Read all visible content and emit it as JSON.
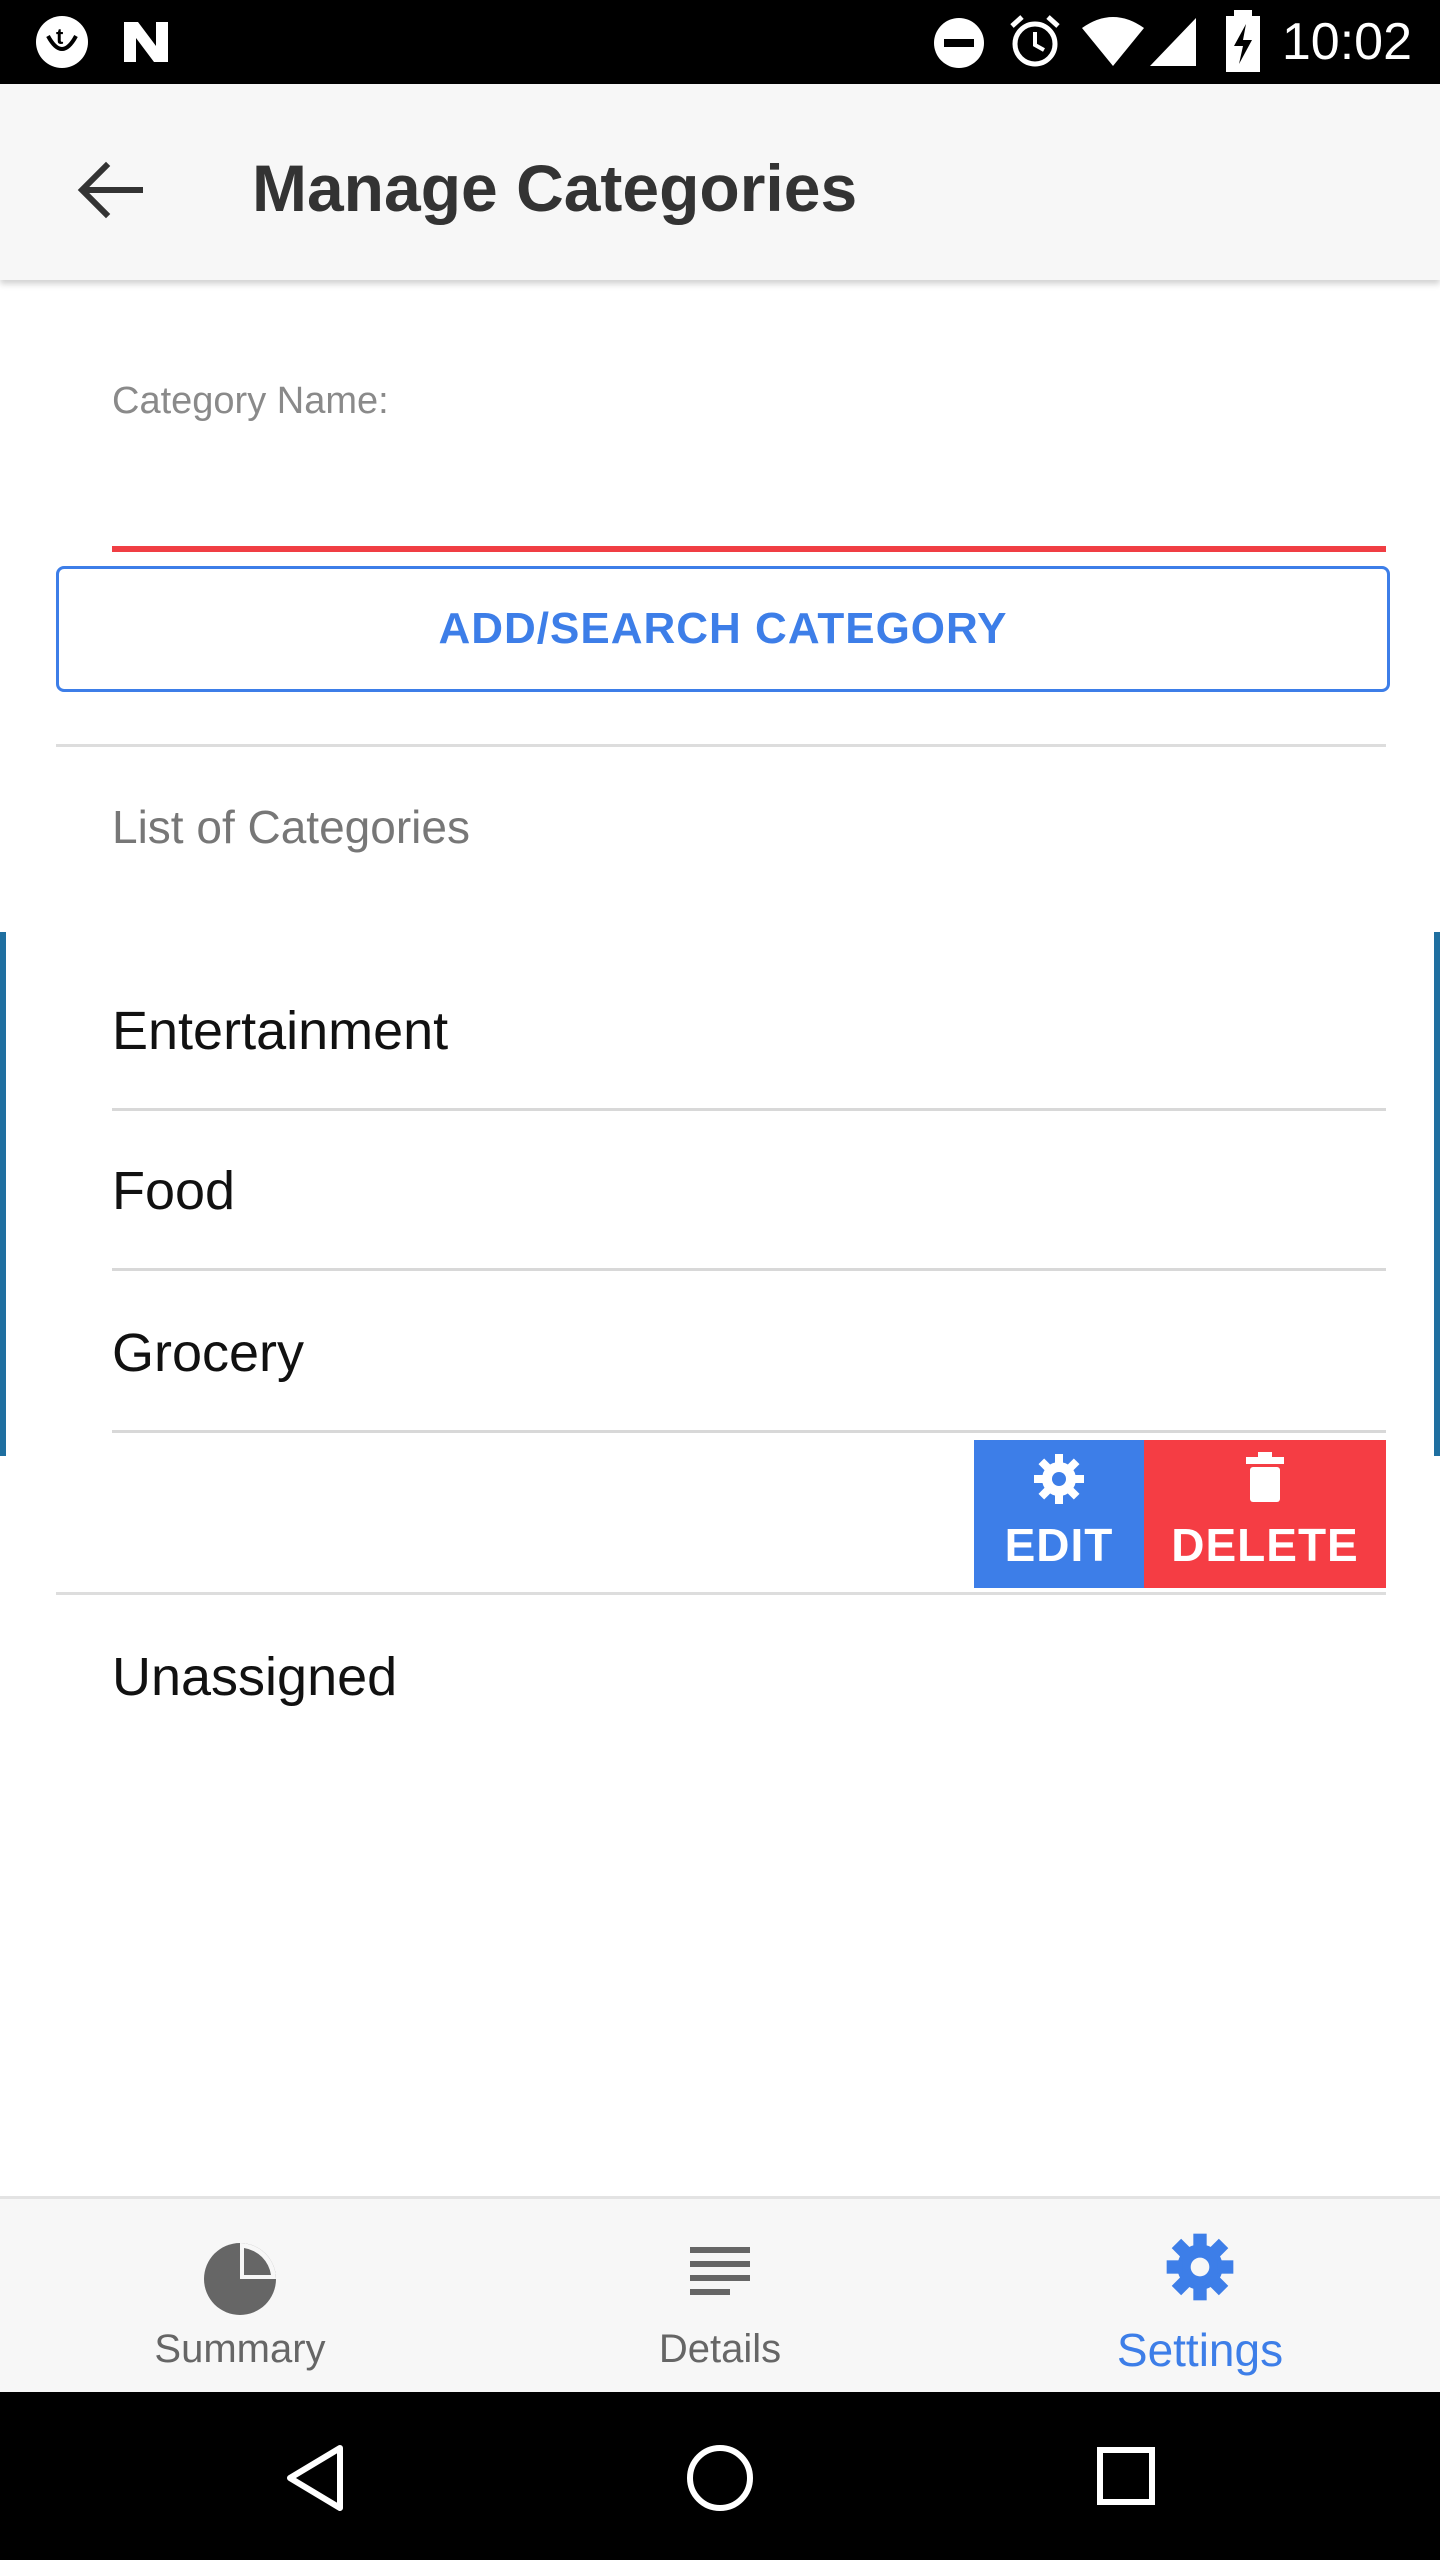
{
  "status_bar": {
    "time": "10:02"
  },
  "app_bar": {
    "title": "Manage Categories"
  },
  "form": {
    "label": "Category Name:",
    "value": "",
    "button_label": "ADD/SEARCH CATEGORY"
  },
  "list": {
    "title": "List of Categories",
    "items": [
      "Entertainment",
      "Food",
      "Grocery",
      "Unassigned"
    ],
    "swipe_actions": {
      "edit": "EDIT",
      "delete": "DELETE"
    }
  },
  "bottom_nav": {
    "items": [
      {
        "label": "Summary",
        "icon": "pie-chart-icon",
        "active": false
      },
      {
        "label": "Details",
        "icon": "lines-icon",
        "active": false
      },
      {
        "label": "Settings",
        "icon": "gear-icon",
        "active": true
      }
    ]
  },
  "colors": {
    "accent": "#3d7ee8",
    "danger": "#f53d44",
    "input_underline": "#f03e44",
    "edge_indicator": "#1f6fa0"
  }
}
